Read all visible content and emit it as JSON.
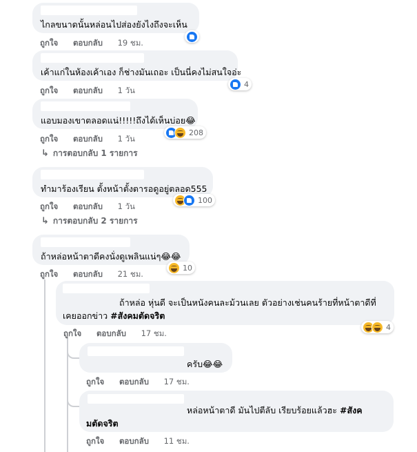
{
  "actions": {
    "like": "ถูกใจ",
    "reply": "ตอบกลับ"
  },
  "comments": [
    {
      "text": "ไกลขนาดนั้นหล่อนไปส่องยังไงถึงจะเห็น",
      "time": "19 ชม.",
      "reactions": [
        "like"
      ],
      "count": ""
    },
    {
      "text": "เค้าแก่ในห้องเค้าเอง ก็ช่างมันเถอะ เป็นนี่คงไม่สนใจอ่ะ",
      "time": "1 วัน",
      "reactions": [
        "like"
      ],
      "count": "4"
    },
    {
      "text": "แอบมองเขาตลอดแน่!!!!!ถึงได้เห็นบ่อย😂",
      "time": "1 วัน",
      "reactions": [
        "like",
        "haha"
      ],
      "count": "208",
      "replies": "การตอบกลับ 1 รายการ"
    },
    {
      "text": "ทำมาร้องเรียน ตั้งหน้าตั้งตารอดูอยู่ตลอด555",
      "time": "1 วัน",
      "reactions": [
        "haha",
        "like"
      ],
      "count": "100",
      "replies": "การตอบกลับ 2 รายการ"
    },
    {
      "text": "ถ้าหล่อหน้าตาดีคงนั่งดูเพลินแน่ๆ😂😂",
      "time": "21 ชม.",
      "reactions": [
        "haha"
      ],
      "count": "10"
    }
  ],
  "replies": [
    {
      "line1": "ถ้าหล่อ หุ่นดี จะเป็นหนังคนละม้วนเลย ตัวอย่างเช่นคนร้ายที่หน้าตาดีที่",
      "line2_pre": "เคยออกข่าว ",
      "line2_tag": "#สังคมตัดจริต",
      "time": "17 ชม.",
      "reactions": [
        "haha",
        "haha"
      ],
      "count": "4"
    },
    {
      "text": "ครับ😂😂",
      "time": "17 ชม."
    },
    {
      "line1_pre": "หล่อหน้าตาดี มันไปตีลับ เรียบร้อยแล้วฮะ ",
      "line1_tag": "#สังค",
      "line2_tag": "มตัดจริต",
      "time": "11 ชม."
    }
  ]
}
